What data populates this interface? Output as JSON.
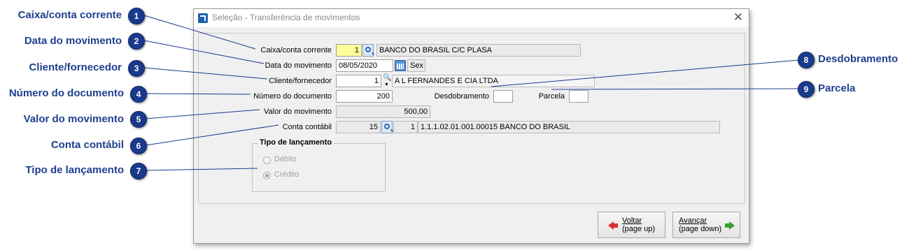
{
  "callouts": {
    "c1": {
      "num": "1",
      "label": "Caixa/conta corrente"
    },
    "c2": {
      "num": "2",
      "label": "Data do movimento"
    },
    "c3": {
      "num": "3",
      "label": "Cliente/fornecedor"
    },
    "c4": {
      "num": "4",
      "label": "Número do documento"
    },
    "c5": {
      "num": "5",
      "label": "Valor do movimento"
    },
    "c6": {
      "num": "6",
      "label": "Conta contábil"
    },
    "c7": {
      "num": "7",
      "label": "Tipo de lançamento"
    },
    "c8": {
      "num": "8",
      "label": "Desdobramento"
    },
    "c9": {
      "num": "9",
      "label": "Parcela"
    }
  },
  "window": {
    "title": "Seleção - Transferência de movimentos",
    "close_icon": "close-icon"
  },
  "form": {
    "caixa": {
      "label": "Caixa/conta corrente",
      "value": "1",
      "description": "BANCO DO BRASIL C/C PLASA"
    },
    "data": {
      "label": "Data do movimento",
      "value": "08/05/2020",
      "weekday": "Sex"
    },
    "cliente": {
      "label": "Cliente/fornecedor",
      "value": "1",
      "description": "A L FERNANDES E CIA LTDA"
    },
    "documento": {
      "label": "Número do documento",
      "value": "200"
    },
    "desdobramento": {
      "label": "Desdobramento",
      "value": ""
    },
    "parcela": {
      "label": "Parcela",
      "value": ""
    },
    "valor": {
      "label": "Valor do movimento",
      "value": "500,00"
    },
    "conta": {
      "label": "Conta contábil",
      "value": "15",
      "code": "1",
      "description": "1.1.1.02.01.001.00015 BANCO DO BRASIL"
    },
    "tipo": {
      "title": "Tipo de lançamento",
      "options": [
        "Débito",
        "Crédito"
      ],
      "selected": "Crédito"
    }
  },
  "buttons": {
    "voltar": {
      "line1": "Voltar",
      "line2": "(page up)"
    },
    "avancar": {
      "line1": "Avançar",
      "line2": "(page down)"
    }
  },
  "colors": {
    "callout_text": "#1f3f8f",
    "badge": "#1a3a8c",
    "focus_field": "#ffff99"
  }
}
